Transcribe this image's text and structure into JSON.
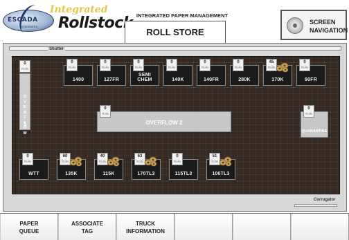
{
  "header": {
    "logo_brand": "ESCADA",
    "logo_sub": "INTEGRATED",
    "logo_integrated": "Integrated",
    "logo_rollstock": "Rollstock",
    "system_title": "INTEGRATED PAPER MANAGEMENT",
    "page_title": "ROLL STORE",
    "screen_nav_label_1": "SCREEN",
    "screen_nav_label_2": "NAVIGATION"
  },
  "layout_labels": {
    "shutter": "Shutter",
    "corrugator": "Corrugator"
  },
  "unit_label": "Rolls",
  "top_lanes": [
    {
      "count": "0",
      "label": "1400"
    },
    {
      "count": "0",
      "label": "127FR"
    },
    {
      "count": "0",
      "label": "SEMI CHEM"
    },
    {
      "count": "0",
      "label": "140K"
    },
    {
      "count": "0",
      "label": "140FR"
    },
    {
      "count": "0",
      "label": "280K"
    },
    {
      "count": "45",
      "label": "170K"
    },
    {
      "count": "0",
      "label": "90FR"
    }
  ],
  "bottom_lanes": [
    {
      "count": "0",
      "label": "WTT"
    },
    {
      "count": "60",
      "label": "135K"
    },
    {
      "count": "40",
      "label": "115K"
    },
    {
      "count": "63",
      "label": "170TL3"
    },
    {
      "count": "0",
      "label": "115TL3"
    },
    {
      "count": "51",
      "label": "100TL3"
    }
  ],
  "overflow1": {
    "count": "0",
    "chars": [
      "O",
      "V",
      "E",
      "R",
      "F",
      "L",
      "O",
      "W"
    ],
    "number": "1"
  },
  "overflow2": {
    "count": "0",
    "label": "OVERFLOW 2"
  },
  "quarantine": {
    "count": "0",
    "label": "QUARANTINE"
  },
  "bottom_nav": [
    {
      "label": "PAPER\nQUEUE"
    },
    {
      "label": "ASSOCIATE\nTAG"
    },
    {
      "label": "TRUCK\nINFORMATION"
    },
    {
      "label": ""
    },
    {
      "label": ""
    },
    {
      "label": ""
    }
  ],
  "colors": {
    "floor": "#342a22",
    "lane": "#1a1a1a",
    "roll": "#c9a25a",
    "logo_gold": "#e3c64a"
  }
}
